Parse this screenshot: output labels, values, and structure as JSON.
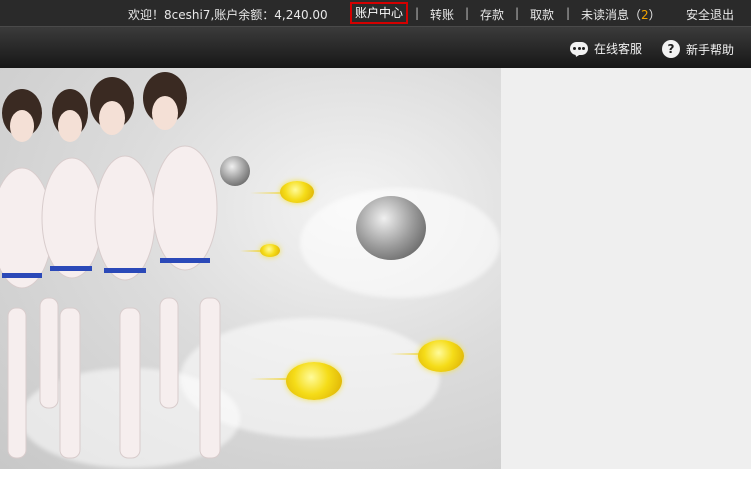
{
  "topbar": {
    "welcome": "欢迎！8ceshi7,账户余额：4,240.00",
    "account_center": "账户中心",
    "transfer": "转账",
    "deposit": "存款",
    "withdraw": "取款",
    "unread_prefix": "未读消息（",
    "unread_count": "2",
    "unread_suffix": "）",
    "logout": "安全退出",
    "separator": "|"
  },
  "helpbar": {
    "online_service": "在线客服",
    "help": "新手帮助",
    "help_icon_glyph": "?"
  },
  "banner": {
    "icons": [
      "chat-bubble-icon",
      "question-mark-icon"
    ],
    "colors": {
      "active_border": "#d40000",
      "badge": "#f2a300",
      "bar_bg": "#2a2a2a"
    }
  }
}
